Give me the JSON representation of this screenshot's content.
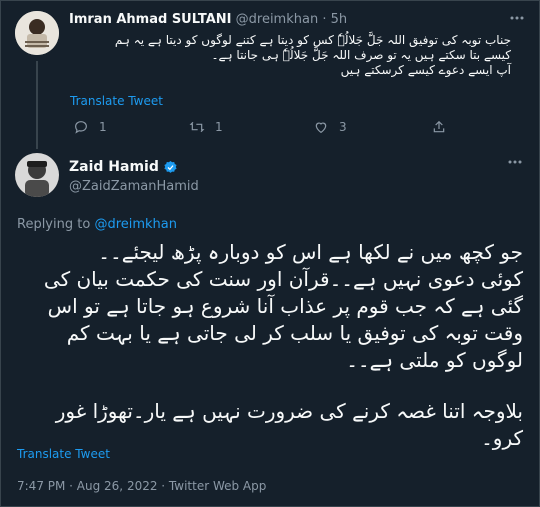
{
  "reply_tweet": {
    "author_name": "Imran Ahmad SULTANI",
    "author_handle": "@dreimkhan",
    "separator": "·",
    "time": "5h",
    "text_lines": [
      "جناب توبہ کی توفیق اللہ جَلَّ جَلالُہٗ کس کو دیتا ہے کتنے لوگوں کو دیتا ہے  یہ ہم",
      "کیسے بتا سکتے ہیں یہ تو صرف اللہ جَلَّ جَلالُہٗ ہی جانتا ہے۔",
      "آپ ایسے دعوے کیسے کرسکتے ہیں"
    ],
    "translate_label": "Translate Tweet",
    "reply_count": "1",
    "retweet_count": "1",
    "like_count": "3"
  },
  "main_tweet": {
    "author_name": "Zaid Hamid",
    "author_handle": "@ZaidZamanHamid",
    "replying_prefix": "Replying to ",
    "replying_mention": "@dreimkhan",
    "text_lines": [
      "جو کچھ میں نے لکھا ہے اس کو دوبارہ پڑھ لیجئے۔۔",
      "کوئی دعوی نہیں ہے۔۔قرآن اور سنت کی حکمت بیان کی",
      "گئی ہے کہ جب قوم پر عذاب آنا شروع ہو جاتا ہے تو اس",
      "وقت توبہ کی توفیق یا سلب کر لی جاتی ہے یا بہت کم",
      "لوگوں کو ملتی ہے۔۔"
    ],
    "text_lines_2": [
      "بلاوجہ اتنا غصہ کرنے کی ضرورت نہیں ہے یار۔تھوڑا غور",
      "کرو۔"
    ],
    "translate_label": "Translate Tweet",
    "timestamp": "7:47 PM · Aug 26, 2022 · Twitter Web App"
  },
  "colors": {
    "background": "#15202b",
    "accent": "#1d9bf0",
    "muted": "#8b98a5",
    "border": "#38444d"
  },
  "icons": {
    "more": "more-horizontal-icon",
    "reply": "reply-icon",
    "retweet": "retweet-icon",
    "like": "heart-icon",
    "share": "share-icon",
    "verified": "verified-badge-icon"
  }
}
